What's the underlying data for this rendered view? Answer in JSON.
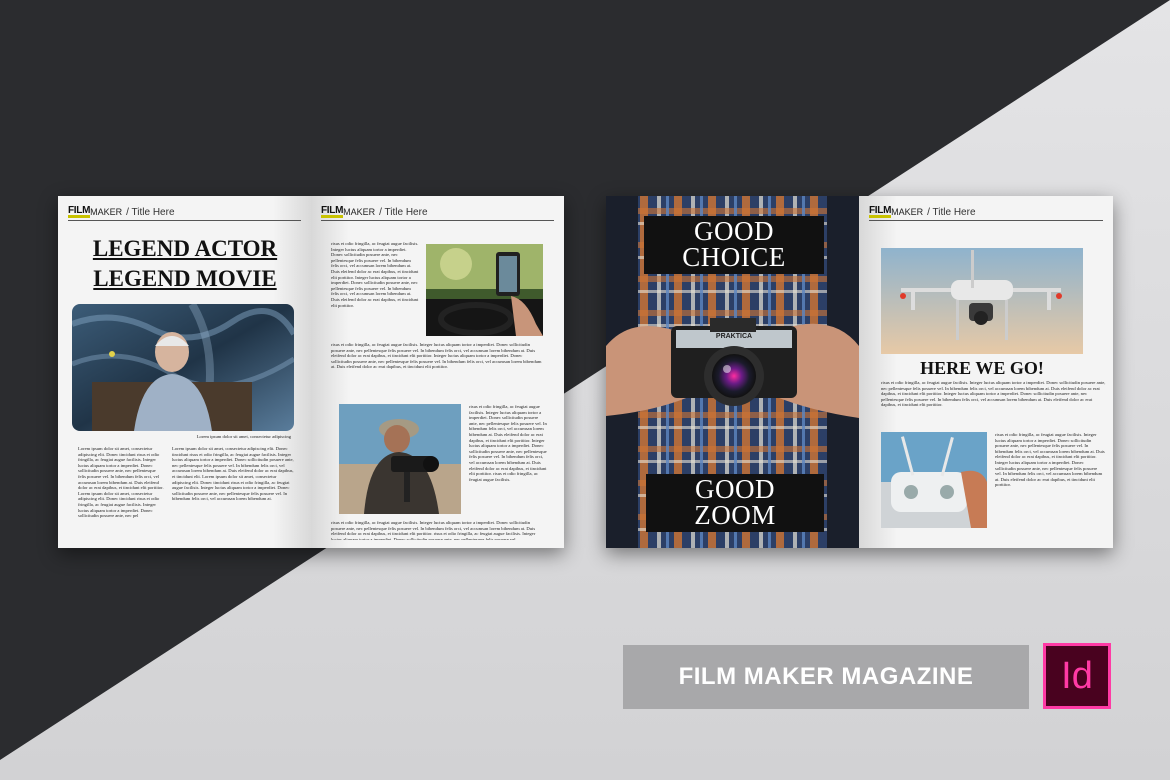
{
  "brand": {
    "film": "FILM",
    "maker": "MAKER",
    "title_sep": " / Title Here"
  },
  "spread1": {
    "headline_line1": "LEGEND ACTOR",
    "headline_line2": "LEGEND MOVIE",
    "caption": "Lorem ipsum dolor sit amet, consectetur adipiscing",
    "body_a": "Lorem ipsum dolor sit amet, consectetur adipiscing elit. Donec tincidunt risus et odio fringilla, ac feugiat augue facilisis. Integer luctus aliquam tortor a imperdiet. Donec sollicitudin posuere ante, nec pellentesque felis posuere vel. In bibendum felis orci, vel accumsan lorem bibendum at. Duis eleifend dolor ac erat dapibus, et tincidunt elit porttitor. Lorem ipsum dolor sit amet, consectetur adipiscing elit. Donec tincidunt risus et odio fringilla, ac feugiat augue facilisis. Integer luctus aliquam tortor a imperdiet. Donec sollicitudin posuere ante, nec pel",
    "body_b": "Lorem ipsum dolor sit amet, consectetur adipiscing elit. Donec tincidunt risus et odio fringilla, ac feugiat augue facilisis. Integer luctus aliquam tortor a imperdiet. Donec sollicitudin posuere ante, nec pellentesque felis posuere vel. In bibendum felis orci, vel accumsan lorem bibendum at. Duis eleifend dolor ac erat dapibus, et tincidunt elit. Lorem ipsum dolor sit amet, consectetur adipiscing elit. Donec tincidunt risus et odio fringilla, ac feugiat augue facilisis. Integer luctus aliquam tortor a imperdiet. Donec sollicitudin posuere ante, nec pellentesque felis posuere vel. In bibendum felis orci, vel accumsan lorem bibendum at.",
    "body_c": "risus et odio fringilla, ac feugiat augue facilisis. Integer luctus aliquam tortor a imperdiet. Donec sollicitudin posuere ante, nec pellentesque felis posuere vel. In bibendum felis orci, vel accumsan lorem bibendum at. Duis eleifend dolor ac erat dapibus, et tincidunt elit porttitor. Integer luctus aliquam tortor a imperdiet. Donec sollicitudin posuere ante, nec pellentesque felis posuere vel. In bibendum felis orci, vel accumsan lorem bibendum at. Duis eleifend dolor ac erat dapibus, et tincidunt elit porttitor.",
    "body_d": "risus et odio fringilla, ac feugiat augue facilisis. Integer luctus aliquam tortor a imperdiet. Donec sollicitudin posuere ante, nec pellentesque felis posuere vel. In bibendum felis orci, vel accumsan lorem bibendum at. Duis eleifend dolor ac erat dapibus, et tincidunt elit porttitor. Integer luctus aliquam tortor a imperdiet. Donec sollicitudin posuere ante, nec pellentesque felis posuere vel. In bibendum felis orci, vel accumsan lorem bibendum at. Duis eleifend dolor ac erat dapibus, et tincidunt elit porttitor.",
    "body_e": "risus et odio fringilla, ac feugiat augue facilisis. Integer luctus aliquam tortor a imperdiet. Donec sollicitudin posuere ante, nec pellentesque felis posuere vel. In bibendum felis orci, vel accumsan lorem bibendum at. Duis eleifend dolor ac erat dapibus, et tincidunt elit porttitor. Integer luctus aliquam tortor a imperdiet. Donec sollicitudin posuere ante, nec pellentesque felis posuere vel. In bibendum felis orci, vel accumsan lorem bibendum at. Duis eleifend dolor ac erat dapibus, et tincidunt elit porttitor. risus et odio fringilla, ac feugiat augue facilisis.",
    "body_f": "risus et odio fringilla, ac feugiat augue facilisis. Integer luctus aliquam tortor a imperdiet. Donec sollicitudin posuere ante, nec pellentesque felis posuere vel. In bibendum felis orci, vel accumsan lorem bibendum at. Duis eleifend dolor ac erat dapibus, et tincidunt elit porttitor. risus et odio fringilla, ac feugiat augue facilisis. Integer luctus aliquam tortor a imperdiet. Donec sollicitudin posuere ante, nec pellentesque felis posuere vel."
  },
  "spread2": {
    "cover_top_1": "GOOD",
    "cover_top_2": "CHOICE",
    "cover_bottom_1": "GOOD",
    "cover_bottom_2": "ZOOM",
    "camera_brand": "PRAKTICA",
    "headline": "HERE WE GO!",
    "body_a": "risus et odio fringilla, ac feugiat augue facilisis. Integer luctus aliquam tortor a imperdiet. Donec sollicitudin posuere ante, nec pellentesque felis posuere vel. In bibendum felis orci, vel accumsan lorem bibendum at. Duis eleifend dolor ac erat dapibus, et tincidunt elit porttitor. Integer luctus aliquam tortor a imperdiet. Donec sollicitudin posuere ante, nec pellentesque felis posuere vel. In bibendum felis orci, vel accumsan lorem bibendum at. Duis eleifend dolor ac erat dapibus, et tincidunt elit porttitor.",
    "body_b": "risus et odio fringilla, ac feugiat augue facilisis. Integer luctus aliquam tortor a imperdiet. Donec sollicitudin posuere ante, nec pellentesque felis posuere vel. In bibendum felis orci, vel accumsan lorem bibendum at. Duis eleifend dolor ac erat dapibus, et tincidunt elit porttitor. Integer luctus aliquam tortor a imperdiet. Donec sollicitudin posuere ante, nec pellentesque felis posuere vel. In bibendum felis orci, vel accumsan lorem bibendum at. Duis eleifend dolor ac erat dapibus, et tincidunt elit porttitor."
  },
  "product_title": "FILM MAKER MAGAZINE",
  "app_logo": "Id",
  "colors": {
    "accent_yellow": "#c8c200",
    "indesign_pink": "#ff3aa5",
    "indesign_bg": "#49021f"
  }
}
